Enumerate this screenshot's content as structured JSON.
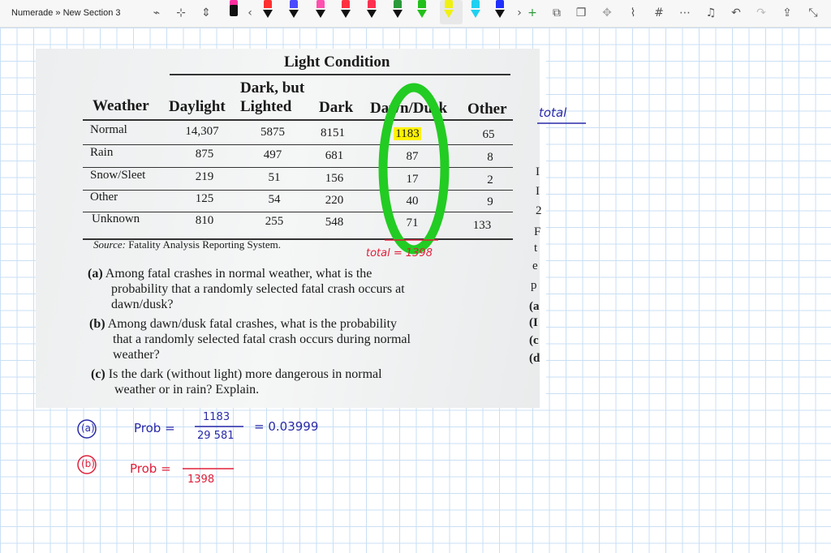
{
  "app": {
    "breadcrumb": "Numerade » New Section 3"
  },
  "toolbar": {
    "pen_colors": [
      "#ff2fa0",
      "#ff3030",
      "#4a4aff",
      "#ff4fb0",
      "#ff3040",
      "#2a9a3a",
      "#22c01a",
      "#f0f010",
      "#20d0f0",
      "#2030ff"
    ],
    "icons": [
      "lasso-icon",
      "add-space-icon",
      "eraser-icon",
      "chevron-left-icon",
      "chevron-right-icon",
      "add-pen-icon",
      "screen-clip-icon",
      "copy-icon",
      "ink-replay-icon",
      "ruler-icon",
      "grid-icon",
      "more-icon",
      "notification-icon",
      "undo-icon",
      "redo-icon",
      "share-icon",
      "fullscreen-icon"
    ]
  },
  "table": {
    "super_header": "Light Condition",
    "col_weather": "Weather",
    "col_daylight": "Daylight",
    "col_darklit_line1": "Dark, but",
    "col_darklit_line2": "Lighted",
    "col_dark": "Dark",
    "col_dawn": "Dawn/Dusk",
    "col_other": "Other",
    "rows": [
      {
        "label": "Normal",
        "daylight": "14,307",
        "darklit": "5875",
        "dark": "8151",
        "dawn": "1183",
        "other": "65"
      },
      {
        "label": "Rain",
        "daylight": "875",
        "darklit": "497",
        "dark": "681",
        "dawn": "87",
        "other": "8"
      },
      {
        "label": "Snow/Sleet",
        "daylight": "219",
        "darklit": "51",
        "dark": "156",
        "dawn": "17",
        "other": "2"
      },
      {
        "label": "Other",
        "daylight": "125",
        "darklit": "54",
        "dark": "220",
        "dawn": "40",
        "other": "9"
      },
      {
        "label": "Unknown",
        "daylight": "810",
        "darklit": "255",
        "dark": "548",
        "dawn": "71",
        "other": "133"
      }
    ],
    "source_label": "Source:",
    "source_text": "Fatality Analysis Reporting System."
  },
  "questions": [
    {
      "letter": "(a)",
      "text_line1": "Among fatal crashes in normal weather, what is the",
      "text_line2": "probability that a randomly selected fatal crash occurs at",
      "text_line3": "dawn/dusk?"
    },
    {
      "letter": "(b)",
      "text_line1": "Among dawn/dusk fatal crashes, what is the probability",
      "text_line2": "that a randomly selected fatal crash occurs during normal",
      "text_line3": "weather?"
    },
    {
      "letter": "(c)",
      "text_line1": "Is the dark (without light) more dangerous in normal",
      "text_line2": "weather or in rain? Explain.",
      "text_line3": ""
    }
  ],
  "margin_letters": [
    "I",
    "I",
    "2",
    "F",
    "t",
    "e",
    "p",
    "(a",
    "(I",
    "(c",
    "(d"
  ],
  "annotations": {
    "total_label": "total",
    "dawn_total": "total = 1398",
    "part_a_label": "(a)",
    "part_a_prob": "Prob =",
    "part_a_num": "1183",
    "part_a_den": "29 581",
    "part_a_result": "= 0.03999",
    "part_b_label": "(b)",
    "part_b_prob": "Prob =",
    "part_b_den": "1398"
  }
}
